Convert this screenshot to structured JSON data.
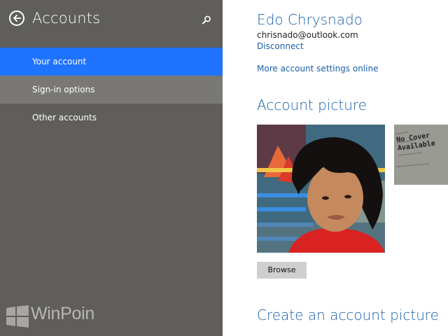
{
  "sidebar": {
    "title": "Accounts",
    "back_icon": "back-arrow-icon",
    "search_icon": "search-icon",
    "items": [
      {
        "label": "Your account",
        "state": "selected"
      },
      {
        "label": "Sign-in options",
        "state": "hover"
      },
      {
        "label": "Other accounts",
        "state": "normal"
      }
    ],
    "watermark": "WinPoin"
  },
  "account": {
    "name": "Edo Chrysnado",
    "email": "chrisnado@outlook.com",
    "disconnect_label": "Disconnect",
    "more_settings_label": "More account settings online"
  },
  "account_picture": {
    "heading": "Account picture",
    "browse_label": "Browse",
    "thumbnail_text": "No Cover Available"
  },
  "create_picture": {
    "heading": "Create an account picture"
  },
  "colors": {
    "sidebar_bg": "#5f5e5b",
    "selected_bg": "#1e73ff",
    "hover_bg": "#797874",
    "accent_text": "#1a5fa8"
  }
}
